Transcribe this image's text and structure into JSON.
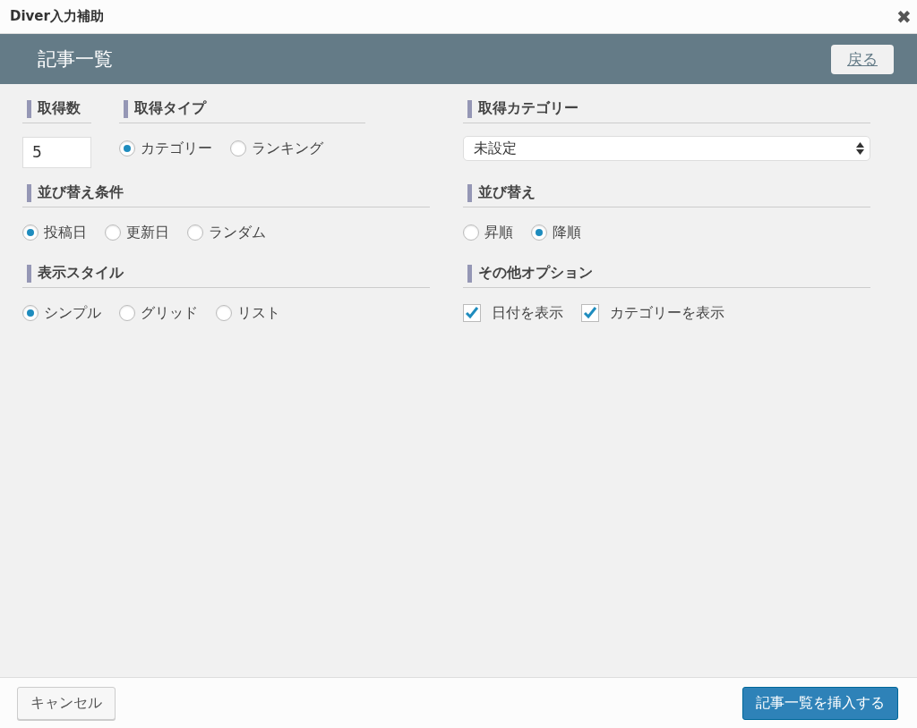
{
  "window": {
    "title": "Diver入力補助",
    "close": "✖"
  },
  "header": {
    "title": "記事一覧",
    "back_button": "戻る"
  },
  "rows": [
    {
      "left": [
        {
          "label": "取得数",
          "kind": "number",
          "value": "5"
        },
        {
          "label": "取得タイプ",
          "kind": "radio",
          "options": [
            {
              "label": "カテゴリー",
              "selected": true
            },
            {
              "label": "ランキング",
              "selected": false
            }
          ]
        }
      ],
      "right": [
        {
          "label": "取得カテゴリー",
          "kind": "select",
          "value": "未設定"
        }
      ]
    },
    {
      "left": [
        {
          "label": "並び替え条件",
          "kind": "radio",
          "options": [
            {
              "label": "投稿日",
              "selected": true
            },
            {
              "label": "更新日",
              "selected": false
            },
            {
              "label": "ランダム",
              "selected": false
            }
          ]
        }
      ],
      "right": [
        {
          "label": "並び替え",
          "kind": "radio",
          "options": [
            {
              "label": "昇順",
              "selected": false
            },
            {
              "label": "降順",
              "selected": true
            }
          ]
        }
      ]
    },
    {
      "left": [
        {
          "label": "表示スタイル",
          "kind": "radio",
          "options": [
            {
              "label": "シンプル",
              "selected": true
            },
            {
              "label": "グリッド",
              "selected": false
            },
            {
              "label": "リスト",
              "selected": false
            }
          ]
        }
      ],
      "right": [
        {
          "label": "その他オプション",
          "kind": "checkbox",
          "options": [
            {
              "label": "日付を表示",
              "checked": true
            },
            {
              "label": "カテゴリーを表示",
              "checked": true
            }
          ]
        }
      ]
    }
  ],
  "footer": {
    "cancel_button": "キャンセル",
    "insert_button": "記事一覧を挿入する"
  }
}
